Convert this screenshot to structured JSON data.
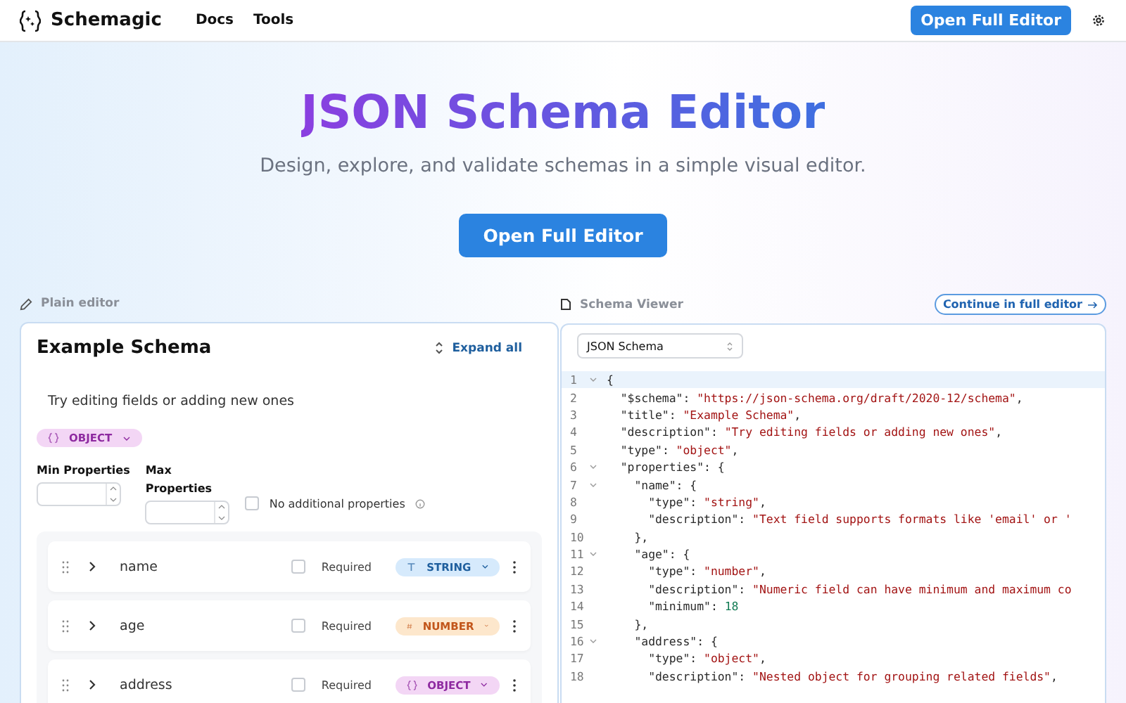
{
  "header": {
    "brand": "Schemagic",
    "nav": [
      {
        "label": "Docs"
      },
      {
        "label": "Tools"
      }
    ],
    "cta": "Open Full Editor"
  },
  "hero": {
    "title": "JSON Schema Editor",
    "subtitle": "Design, explore, and validate schemas in a simple visual editor.",
    "button": "Open Full Editor"
  },
  "editor": {
    "label": "Plain editor",
    "title": "Example Schema",
    "expand_label": "Expand all",
    "description": "Try editing fields or adding new ones",
    "type_badge": {
      "label": "OBJECT",
      "kind": "object"
    },
    "min_label": "Min Properties",
    "max_label": "Max Properties",
    "no_additional": {
      "label": "No additional properties",
      "checked": false
    },
    "properties": [
      {
        "name": "name",
        "required_label": "Required",
        "required": false,
        "type_label": "STRING",
        "kind": "string"
      },
      {
        "name": "age",
        "required_label": "Required",
        "required": false,
        "type_label": "NUMBER",
        "kind": "number"
      },
      {
        "name": "address",
        "required_label": "Required",
        "required": false,
        "type_label": "OBJECT",
        "kind": "object"
      }
    ]
  },
  "viewer": {
    "label": "Schema Viewer",
    "continue_label": "Continue in full editor",
    "format": "JSON Schema",
    "lines": [
      {
        "number": "1",
        "foldable": true,
        "active": true,
        "tokens": [
          {
            "kind": "punct",
            "s": "{"
          }
        ]
      },
      {
        "number": "2",
        "foldable": false,
        "active": false,
        "tokens": [
          {
            "kind": "key",
            "s": "  \"$schema\""
          },
          {
            "kind": "punct",
            "s": ": "
          },
          {
            "kind": "string",
            "s": "\"https://json-schema.org/draft/2020-12/schema\""
          },
          {
            "kind": "punct",
            "s": ","
          }
        ]
      },
      {
        "number": "3",
        "foldable": false,
        "active": false,
        "tokens": [
          {
            "kind": "key",
            "s": "  \"title\""
          },
          {
            "kind": "punct",
            "s": ": "
          },
          {
            "kind": "string",
            "s": "\"Example Schema\""
          },
          {
            "kind": "punct",
            "s": ","
          }
        ]
      },
      {
        "number": "4",
        "foldable": false,
        "active": false,
        "tokens": [
          {
            "kind": "key",
            "s": "  \"description\""
          },
          {
            "kind": "punct",
            "s": ": "
          },
          {
            "kind": "string",
            "s": "\"Try editing fields or adding new ones\""
          },
          {
            "kind": "punct",
            "s": ","
          }
        ]
      },
      {
        "number": "5",
        "foldable": false,
        "active": false,
        "tokens": [
          {
            "kind": "key",
            "s": "  \"type\""
          },
          {
            "kind": "punct",
            "s": ": "
          },
          {
            "kind": "string",
            "s": "\"object\""
          },
          {
            "kind": "punct",
            "s": ","
          }
        ]
      },
      {
        "number": "6",
        "foldable": true,
        "active": false,
        "tokens": [
          {
            "kind": "key",
            "s": "  \"properties\""
          },
          {
            "kind": "punct",
            "s": ": {"
          }
        ]
      },
      {
        "number": "7",
        "foldable": true,
        "active": false,
        "tokens": [
          {
            "kind": "key",
            "s": "    \"name\""
          },
          {
            "kind": "punct",
            "s": ": {"
          }
        ]
      },
      {
        "number": "8",
        "foldable": false,
        "active": false,
        "tokens": [
          {
            "kind": "key",
            "s": "      \"type\""
          },
          {
            "kind": "punct",
            "s": ": "
          },
          {
            "kind": "string",
            "s": "\"string\""
          },
          {
            "kind": "punct",
            "s": ","
          }
        ]
      },
      {
        "number": "9",
        "foldable": false,
        "active": false,
        "tokens": [
          {
            "kind": "key",
            "s": "      \"description\""
          },
          {
            "kind": "punct",
            "s": ": "
          },
          {
            "kind": "string",
            "s": "\"Text field supports formats like 'email' or '"
          }
        ]
      },
      {
        "number": "10",
        "foldable": false,
        "active": false,
        "tokens": [
          {
            "kind": "punct",
            "s": "    },"
          }
        ]
      },
      {
        "number": "11",
        "foldable": true,
        "active": false,
        "tokens": [
          {
            "kind": "key",
            "s": "    \"age\""
          },
          {
            "kind": "punct",
            "s": ": {"
          }
        ]
      },
      {
        "number": "12",
        "foldable": false,
        "active": false,
        "tokens": [
          {
            "kind": "key",
            "s": "      \"type\""
          },
          {
            "kind": "punct",
            "s": ": "
          },
          {
            "kind": "string",
            "s": "\"number\""
          },
          {
            "kind": "punct",
            "s": ","
          }
        ]
      },
      {
        "number": "13",
        "foldable": false,
        "active": false,
        "tokens": [
          {
            "kind": "key",
            "s": "      \"description\""
          },
          {
            "kind": "punct",
            "s": ": "
          },
          {
            "kind": "string",
            "s": "\"Numeric field can have minimum and maximum co"
          }
        ]
      },
      {
        "number": "14",
        "foldable": false,
        "active": false,
        "tokens": [
          {
            "kind": "key",
            "s": "      \"minimum\""
          },
          {
            "kind": "punct",
            "s": ": "
          },
          {
            "kind": "number",
            "s": "18"
          }
        ]
      },
      {
        "number": "15",
        "foldable": false,
        "active": false,
        "tokens": [
          {
            "kind": "punct",
            "s": "    },"
          }
        ]
      },
      {
        "number": "16",
        "foldable": true,
        "active": false,
        "tokens": [
          {
            "kind": "key",
            "s": "    \"address\""
          },
          {
            "kind": "punct",
            "s": ": {"
          }
        ]
      },
      {
        "number": "17",
        "foldable": false,
        "active": false,
        "tokens": [
          {
            "kind": "key",
            "s": "      \"type\""
          },
          {
            "kind": "punct",
            "s": ": "
          },
          {
            "kind": "string",
            "s": "\"object\""
          },
          {
            "kind": "punct",
            "s": ","
          }
        ]
      },
      {
        "number": "18",
        "foldable": false,
        "active": false,
        "tokens": [
          {
            "kind": "key",
            "s": "      \"description\""
          },
          {
            "kind": "punct",
            "s": ": "
          },
          {
            "kind": "string",
            "s": "\"Nested object for grouping related fields\""
          },
          {
            "kind": "punct",
            "s": ","
          }
        ]
      }
    ]
  }
}
